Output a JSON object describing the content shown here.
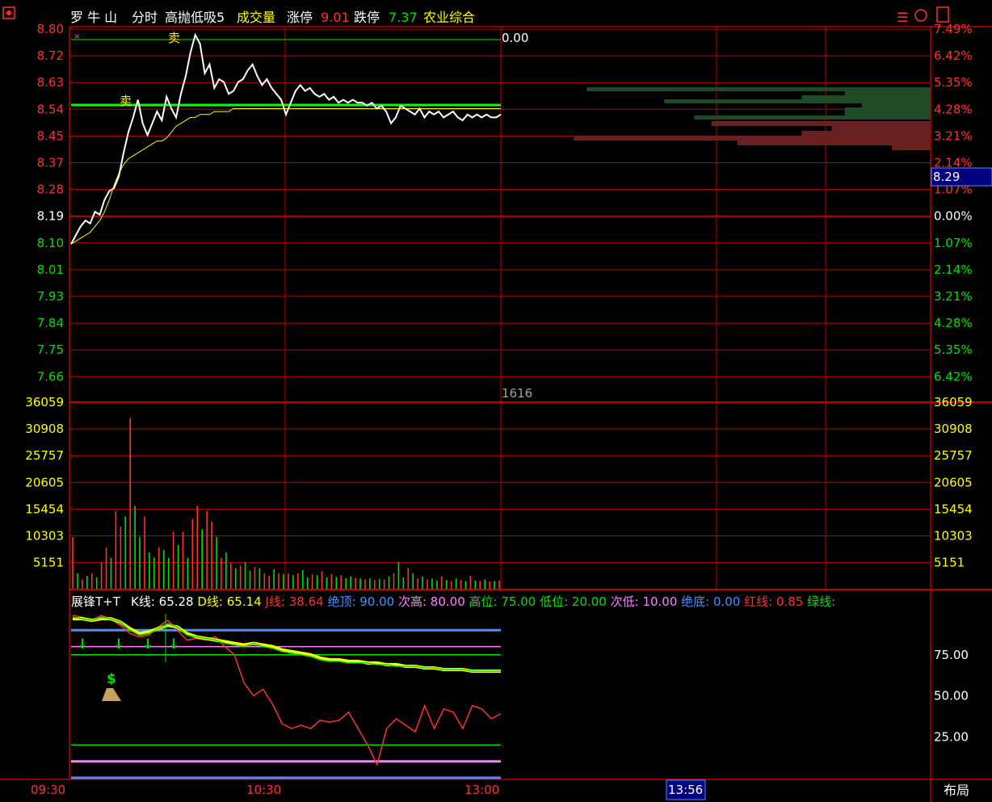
{
  "header": {
    "stock_name": "罗 牛 山",
    "mode": "分时",
    "indicator": "高抛低吸5",
    "volume_label": "成交量",
    "limit_up_label": "涨停",
    "limit_up_value": "9.01",
    "limit_down_label": "跌停",
    "limit_down_value": "7.37",
    "sector": "农业综合"
  },
  "price_panel": {
    "left_ticks": [
      "8.80",
      "8.72",
      "8.63",
      "8.54",
      "8.45",
      "8.37",
      "8.28",
      "8.19",
      "8.10",
      "8.01",
      "7.93",
      "7.84",
      "7.75",
      "7.66"
    ],
    "right_ticks": [
      "7.49%",
      "6.42%",
      "5.35%",
      "4.28%",
      "3.21%",
      "2.14%",
      "1.07%",
      "0.00%",
      "1.07%",
      "2.14%",
      "3.21%",
      "4.28%",
      "5.35%",
      "6.42%"
    ],
    "ylim": [
      7.62,
      8.8
    ],
    "current_price_tag": "8.29",
    "sell_label": "卖",
    "top_line_value": "0.00",
    "price_series": [
      8.07,
      8.1,
      8.13,
      8.15,
      8.14,
      8.18,
      8.17,
      8.22,
      8.25,
      8.26,
      8.3,
      8.38,
      8.45,
      8.5,
      8.56,
      8.48,
      8.44,
      8.48,
      8.52,
      8.49,
      8.57,
      8.53,
      8.5,
      8.58,
      8.64,
      8.72,
      8.78,
      8.75,
      8.65,
      8.68,
      8.6,
      8.63,
      8.62,
      8.58,
      8.59,
      8.62,
      8.63,
      8.66,
      8.68,
      8.64,
      8.61,
      8.63,
      8.6,
      8.58,
      8.56,
      8.51,
      8.55,
      8.59,
      8.61,
      8.59,
      8.6,
      8.58,
      8.57,
      8.58,
      8.56,
      8.57,
      8.55,
      8.56,
      8.55,
      8.56,
      8.55,
      8.55,
      8.54,
      8.55,
      8.53,
      8.54,
      8.52,
      8.48,
      8.5,
      8.54,
      8.53,
      8.52,
      8.51,
      8.53,
      8.5,
      8.52,
      8.51,
      8.52,
      8.5,
      8.51,
      8.52,
      8.5,
      8.49,
      8.51,
      8.5,
      8.51,
      8.5,
      8.51,
      8.5,
      8.5,
      8.51
    ],
    "avg_series": [
      8.07,
      8.08,
      8.09,
      8.1,
      8.11,
      8.13,
      8.15,
      8.18,
      8.22,
      8.27,
      8.31,
      8.34,
      8.36,
      8.37,
      8.38,
      8.39,
      8.4,
      8.41,
      8.42,
      8.42,
      8.43,
      8.45,
      8.47,
      8.48,
      8.49,
      8.5,
      8.5,
      8.51,
      8.51,
      8.51,
      8.52,
      8.52,
      8.52,
      8.52,
      8.53,
      8.53,
      8.53,
      8.53,
      8.53,
      8.53,
      8.53,
      8.53,
      8.53,
      8.53,
      8.53,
      8.53,
      8.53,
      8.53,
      8.53,
      8.53,
      8.53,
      8.53,
      8.53,
      8.53,
      8.53,
      8.53,
      8.53,
      8.53,
      8.53,
      8.53,
      8.53,
      8.53,
      8.53,
      8.53,
      8.53,
      8.53,
      8.53,
      8.53,
      8.53,
      8.53,
      8.53,
      8.53,
      8.53,
      8.53,
      8.53,
      8.53,
      8.53,
      8.53,
      8.53,
      8.53,
      8.53,
      8.53,
      8.53,
      8.53,
      8.53,
      8.53,
      8.53,
      8.53,
      8.53,
      8.53,
      8.53
    ]
  },
  "order_book": {
    "buy_bars": [
      0.8,
      0.2,
      0.3,
      0.62,
      0.16,
      0.2,
      0.2,
      0.55
    ],
    "sell_bars": [
      0.51,
      0.23,
      0.3,
      0.83,
      0.45,
      0.09
    ]
  },
  "volume_panel": {
    "left_ticks": [
      "36059",
      "30908",
      "25757",
      "20605",
      "15454",
      "10303",
      "5151"
    ],
    "right_ticks": [
      "36059",
      "30908",
      "25757",
      "20605",
      "15454",
      "10303",
      "5151"
    ],
    "ylim": [
      0,
      36059
    ],
    "marker_value": "1616",
    "volumes": [
      10000,
      3000,
      1800,
      2500,
      3000,
      2200,
      5000,
      8000,
      6000,
      15000,
      12000,
      14000,
      33000,
      16000,
      10000,
      14000,
      7000,
      6000,
      8000,
      7500,
      6000,
      11000,
      8500,
      11000,
      6000,
      13500,
      16000,
      11500,
      15000,
      13000,
      10000,
      6000,
      7000,
      5000,
      4000,
      4500,
      5200,
      3500,
      4200,
      4000,
      3000,
      2500,
      3800,
      3000,
      2800,
      3000,
      2600,
      3000,
      3600,
      2200,
      2800,
      2600,
      3400,
      2200,
      2800,
      2300,
      2600,
      2000,
      2400,
      2100,
      2000,
      1800,
      2000,
      1700,
      1900,
      1800,
      2400,
      3000,
      5200,
      2200,
      4000,
      3000,
      2000,
      2400,
      1800,
      2000,
      1600,
      2400,
      1700,
      1500,
      2000,
      1700,
      1500,
      2500,
      1600,
      1500,
      1800,
      1400,
      1500,
      1616
    ],
    "up_flags": [
      1,
      0,
      1,
      0,
      1,
      0,
      1,
      1,
      0,
      1,
      1,
      0,
      1,
      0,
      0,
      1,
      0,
      0,
      1,
      0,
      0,
      1,
      0,
      1,
      0,
      1,
      1,
      0,
      1,
      1,
      0,
      1,
      0,
      1,
      0,
      1,
      0,
      0,
      1,
      0,
      1,
      1,
      0,
      1,
      0,
      1,
      0,
      1,
      0,
      0,
      1,
      0,
      1,
      0,
      1,
      0,
      1,
      0,
      0,
      1,
      0,
      1,
      0,
      1,
      0,
      1,
      0,
      1,
      0,
      0,
      1,
      0,
      1,
      0,
      1,
      0,
      0,
      1,
      0,
      1,
      0,
      1,
      0,
      1,
      0,
      1,
      0,
      1,
      0,
      1
    ]
  },
  "indicator_panel": {
    "name": "展锋T+T",
    "labels": [
      {
        "text": "K线: ",
        "value": "65.28",
        "color": "#ffffff"
      },
      {
        "text": "D线: ",
        "value": "65.14",
        "color": "#ffff00"
      },
      {
        "text": "J线: ",
        "value": "38.64",
        "color": "#ff3030"
      },
      {
        "text": "绝顶: ",
        "value": "90.00",
        "color": "#4a90ff"
      },
      {
        "text": "次高: ",
        "value": "80.00",
        "color": "#ff80ff"
      },
      {
        "text": "高位: ",
        "value": "75.00",
        "color": "#00e000"
      },
      {
        "text": "低位: ",
        "value": "20.00",
        "color": "#00e000"
      },
      {
        "text": "次低: ",
        "value": "10.00",
        "color": "#ff80ff"
      },
      {
        "text": "绝底: ",
        "value": "0.00",
        "color": "#4a90ff"
      },
      {
        "text": "红线: ",
        "value": "0.85",
        "color": "#ff3030"
      },
      {
        "text": "绿线: ",
        "value": "",
        "color": "#00e000"
      }
    ],
    "right_ticks": [
      "75.00",
      "50.00",
      "25.00"
    ],
    "ylim": [
      0,
      100
    ],
    "levels": [
      90,
      80,
      75,
      20,
      10,
      0
    ],
    "k_series": [
      98,
      97,
      96,
      98,
      97,
      95,
      90,
      87,
      88,
      91,
      94,
      92,
      87,
      86,
      85,
      84,
      82,
      81,
      80,
      82,
      80,
      79,
      77,
      76,
      75,
      74,
      72,
      71,
      71,
      70,
      70,
      70,
      69,
      69,
      68,
      68,
      68,
      67,
      67,
      66,
      66,
      66,
      65,
      65,
      65,
      65
    ],
    "d_series": [
      97,
      97,
      96,
      97,
      97,
      95,
      91,
      88,
      89,
      91,
      93,
      92,
      88,
      86,
      85,
      84,
      83,
      82,
      81,
      82,
      81,
      80,
      78,
      77,
      76,
      75,
      73,
      72,
      72,
      71,
      71,
      70,
      70,
      69,
      69,
      68,
      68,
      67,
      67,
      66,
      66,
      66,
      65,
      65,
      65,
      65
    ],
    "j_series": [
      99,
      98,
      96,
      99,
      97,
      93,
      88,
      86,
      87,
      92,
      96,
      90,
      84,
      85,
      84,
      86,
      80,
      75,
      58,
      50,
      54,
      45,
      33,
      30,
      32,
      30,
      35,
      34,
      35,
      40,
      30,
      20,
      8,
      30,
      36,
      32,
      28,
      44,
      30,
      42,
      40,
      30,
      44,
      42,
      36,
      39
    ],
    "sell_arrow_label": "↓",
    "buy_signal_label": "$"
  },
  "time_axis": {
    "labels": [
      "09:30",
      "10:30",
      "13:00"
    ],
    "cursor_time": "13:56",
    "layout_button": "布局"
  },
  "colors": {
    "grid": "#c00000",
    "price_line": "#ffffff",
    "avg_line": "#ffff00",
    "up": "#ff3030",
    "down": "#00e000",
    "tag_bg": "#000080"
  }
}
